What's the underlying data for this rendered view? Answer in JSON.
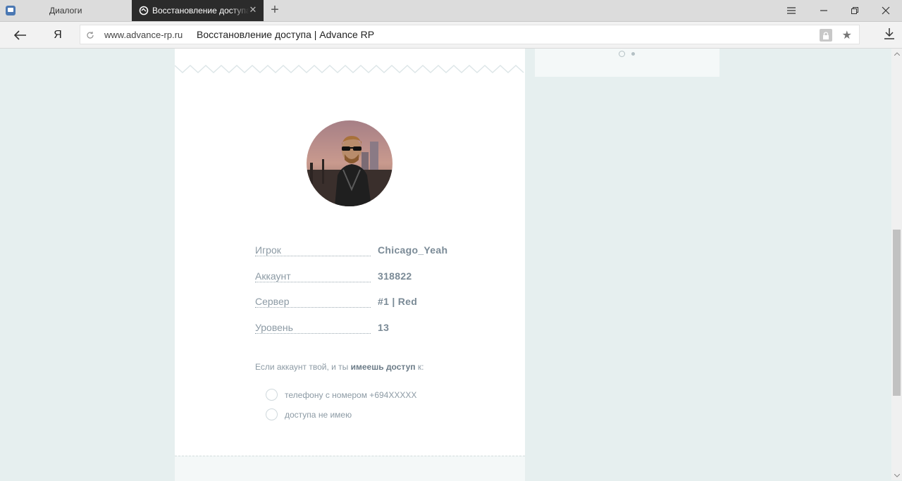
{
  "browser": {
    "tabs": [
      {
        "title": "Диалоги",
        "active": false
      },
      {
        "title": "Восстановление доступа",
        "active": true
      }
    ],
    "url_domain": "www.advance-rp.ru",
    "page_title": "Восстановление доступа | Advance RP",
    "omnibox_logo": "Я"
  },
  "player": {
    "rows": [
      {
        "label": "Игрок",
        "value": "Chicago_Yeah"
      },
      {
        "label": "Аккаунт",
        "value": "318822"
      },
      {
        "label": "Сервер",
        "value": "#1 | Red"
      },
      {
        "label": "Уровень",
        "value": "13"
      }
    ]
  },
  "recovery": {
    "prompt_start": "Если аккаунт твой, и ты ",
    "prompt_bold": "имеешь доступ",
    "prompt_end": " к:",
    "options": [
      "телефону с номером +694XXXXX",
      "доступа не имею"
    ]
  },
  "colors": {
    "page_bg": "#e6efef",
    "card_bg": "#ffffff",
    "label_text": "#8c9aa4",
    "value_text": "#7a8a96",
    "active_tab": "#2b2b2b"
  }
}
